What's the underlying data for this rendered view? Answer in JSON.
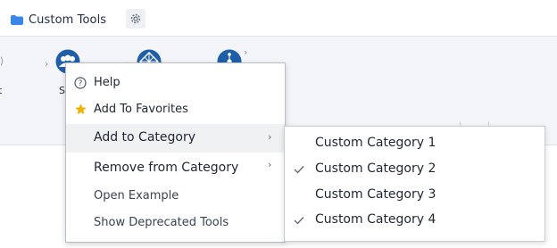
{
  "tab": {
    "label": "Custom Tools"
  },
  "ribbon": {
    "tools": [
      {
        "icon": "chart-tool-icon",
        "label": "t"
      },
      {
        "icon": "people-tool-icon",
        "label": "S"
      },
      {
        "icon": "grid-globe-tool-icon",
        "label": ""
      },
      {
        "icon": "network-tool-icon",
        "label": ""
      }
    ]
  },
  "context_menu": {
    "help": "Help",
    "add_favorites": "Add To Favorites",
    "add_category": "Add to Category",
    "remove_category": "Remove from Category",
    "open_example": "Open Example",
    "show_deprecated": "Show Deprecated Tools"
  },
  "submenu": {
    "items": [
      {
        "label": "Custom Category 1",
        "checked": false
      },
      {
        "label": "Custom Category 2",
        "checked": true
      },
      {
        "label": "Custom Category 3",
        "checked": false
      },
      {
        "label": "Custom Category 4",
        "checked": true
      }
    ]
  },
  "colors": {
    "accent": "#1f5fa8",
    "star": "#f2b200",
    "folder": "#3a86e8"
  }
}
